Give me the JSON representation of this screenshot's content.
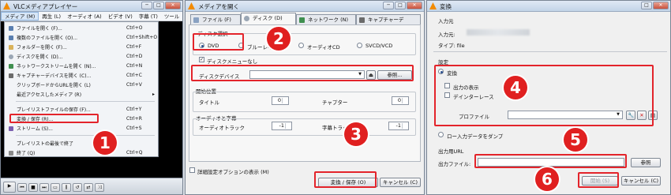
{
  "colors": {
    "highlight": "#e3242b",
    "badge": "#e02020",
    "vlc_orange": "#f28b00"
  },
  "vlc": {
    "title": "VLCメディアプレイヤー",
    "menubar": [
      "メディア (M)",
      "再生 (L)",
      "オーディオ (A)",
      "ビデオ (V)",
      "字幕 (T)",
      "ツール"
    ],
    "menu_items": [
      {
        "label": "ファイルを開く (F)...",
        "shortcut": "Ctrl+O",
        "icon": "file-icon"
      },
      {
        "label": "複数のファイルを開く (O)...",
        "shortcut": "Ctrl+Shift+O",
        "icon": "files-icon"
      },
      {
        "label": "フォルダーを開く (F)...",
        "shortcut": "Ctrl+F",
        "icon": "folder-icon"
      },
      {
        "label": "ディスクを開く (D)...",
        "shortcut": "Ctrl+D",
        "icon": "disc-icon"
      },
      {
        "label": "ネットワークストリームを開く (N)...",
        "shortcut": "Ctrl+N",
        "icon": "network-icon"
      },
      {
        "label": "キャプチャーデバイスを開く (C)...",
        "shortcut": "Ctrl+C",
        "icon": "capture-icon"
      },
      {
        "label": "クリップボードからURLを開く (L)",
        "shortcut": "Ctrl+V",
        "icon": ""
      },
      {
        "label": "最近アクセスしたメディア (R)",
        "shortcut": "▸",
        "icon": ""
      },
      {
        "label": "プレイリストファイルの保存 (F)...",
        "shortcut": "Ctrl+Y",
        "icon": ""
      },
      {
        "label": "変換 / 保存 (R)...",
        "shortcut": "Ctrl+R",
        "icon": ""
      },
      {
        "label": "ストリーム (S)...",
        "shortcut": "Ctrl+S",
        "icon": "stream-icon"
      },
      {
        "label": "プレイリストの最後で終了",
        "shortcut": "",
        "icon": ""
      },
      {
        "label": "終了 (Q)",
        "shortcut": "Ctrl+Q",
        "icon": "exit-icon"
      }
    ],
    "player_buttons": [
      "▶",
      "⏮",
      "■",
      "⏭",
      "▭",
      "⫼",
      "↺",
      "⇄",
      "⤨"
    ]
  },
  "open_media": {
    "title": "メディアを開く",
    "tabs": [
      "ファイル (F)",
      "ディスク (D)",
      "ネットワーク (N)",
      "キャプチャーデ"
    ],
    "disc_select_label": "ディスク選択",
    "disc_options": [
      "DVD",
      "ブルーレイ",
      "オーディオCD",
      "SVCD/VCD"
    ],
    "no_menu_label": "ディスクメニューなし",
    "device_label": "ディスクデバイス",
    "browse_label": "参照...",
    "start_pos_label": "開始位置",
    "title_label": "タイトル",
    "title_value": "0",
    "chapter_label": "チャプター",
    "chapter_value": "0",
    "audio_sub_label": "オーディオと字幕",
    "audio_track_label": "オーディオトラック",
    "audio_track_value": "-1",
    "sub_track_label": "字幕トラック",
    "sub_track_value": "-1",
    "advanced_label": "詳細設定オプションの表示 (M)",
    "convert_label": "変換 / 保存 (O)",
    "cancel_label": "キャンセル (C)"
  },
  "convert": {
    "title": "変換",
    "source_label": "入力元",
    "source_field_label": "入力元:",
    "type_label": "タイプ: file",
    "settings_label": "設定",
    "convert_option": "変換",
    "show_output": "出力の表示",
    "deinterlace": "デインターレース",
    "profile_label": "プロファイル",
    "dump_option": "ロー入力データをダンプ",
    "dest_label": "出力用URL",
    "dest_file_label": "出力ファイル:",
    "browse_label": "参照",
    "start_label": "開始 (S)",
    "cancel_label": "キャンセル (C)"
  },
  "badges": [
    "1",
    "2",
    "3",
    "4",
    "5",
    "6"
  ]
}
